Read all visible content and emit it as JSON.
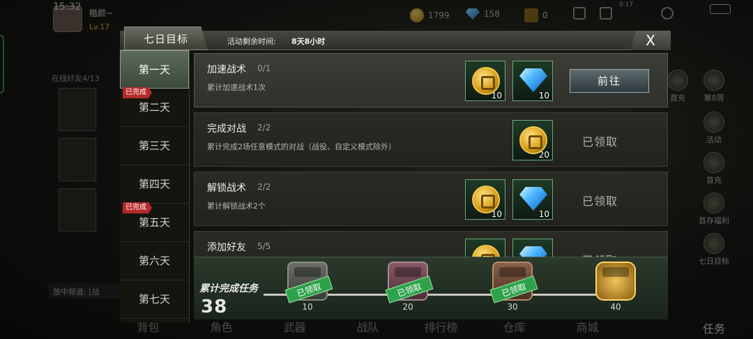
{
  "status": {
    "time": "15:32",
    "player_name": "楷颜~",
    "level": "Lv.17",
    "coins": "1799",
    "gems": "158",
    "tickets": "0",
    "net": "0.17"
  },
  "background": {
    "friends_online": "在线好友4/13",
    "chat_placeholder": "放中频道: [战",
    "right_menu": [
      "首充",
      "第8周",
      "活动",
      "首充",
      "首存福利",
      "七日目标"
    ],
    "bottom_nav": [
      "背包",
      "角色",
      "武器",
      "战队",
      "排行榜",
      "仓库",
      "商城"
    ],
    "bottom_task": "任务"
  },
  "dialog": {
    "title": "七日目标",
    "timer_label": "活动剩余时间:",
    "timer_value": "8天8小时",
    "close_label": "X",
    "completed_badge": "已完成",
    "days": [
      {
        "label": "第一天",
        "completed": false,
        "active": true
      },
      {
        "label": "第二天",
        "completed": true,
        "active": false
      },
      {
        "label": "第三天",
        "completed": false,
        "active": false
      },
      {
        "label": "第四天",
        "completed": false,
        "active": false
      },
      {
        "label": "第五天",
        "completed": true,
        "active": false
      },
      {
        "label": "第六天",
        "completed": false,
        "active": false
      },
      {
        "label": "第七天",
        "completed": false,
        "active": false
      }
    ],
    "tasks": [
      {
        "title": "加速战术",
        "progress": "0/1",
        "desc": "累计加速战术1次",
        "rewards": [
          {
            "type": "coin",
            "qty": "10"
          },
          {
            "type": "gem",
            "qty": "10"
          }
        ],
        "action": "前往",
        "claimed": false
      },
      {
        "title": "完成对战",
        "progress": "2/2",
        "desc": "累计完成2场任意模式的对战（战役、自定义模式除外）",
        "rewards": [
          {
            "type": "coin",
            "qty": "20"
          }
        ],
        "action": "已领取",
        "claimed": true
      },
      {
        "title": "解锁战术",
        "progress": "2/2",
        "desc": "累计解锁战术2个",
        "rewards": [
          {
            "type": "coin",
            "qty": "10"
          },
          {
            "type": "gem",
            "qty": "10"
          }
        ],
        "action": "已领取",
        "claimed": true
      },
      {
        "title": "添加好友",
        "progress": "5/5",
        "desc": "",
        "rewards": [
          {
            "type": "coin",
            "qty": ""
          },
          {
            "type": "gem",
            "qty": ""
          }
        ],
        "action": "已领取",
        "claimed": true
      }
    ],
    "cumulative": {
      "label": "累计完成任务",
      "count": "38",
      "claimed_stamp": "已领取",
      "milestones": [
        {
          "value": "10",
          "claimed": true
        },
        {
          "value": "20",
          "claimed": true
        },
        {
          "value": "30",
          "claimed": true
        },
        {
          "value": "40",
          "claimed": false
        }
      ]
    }
  }
}
